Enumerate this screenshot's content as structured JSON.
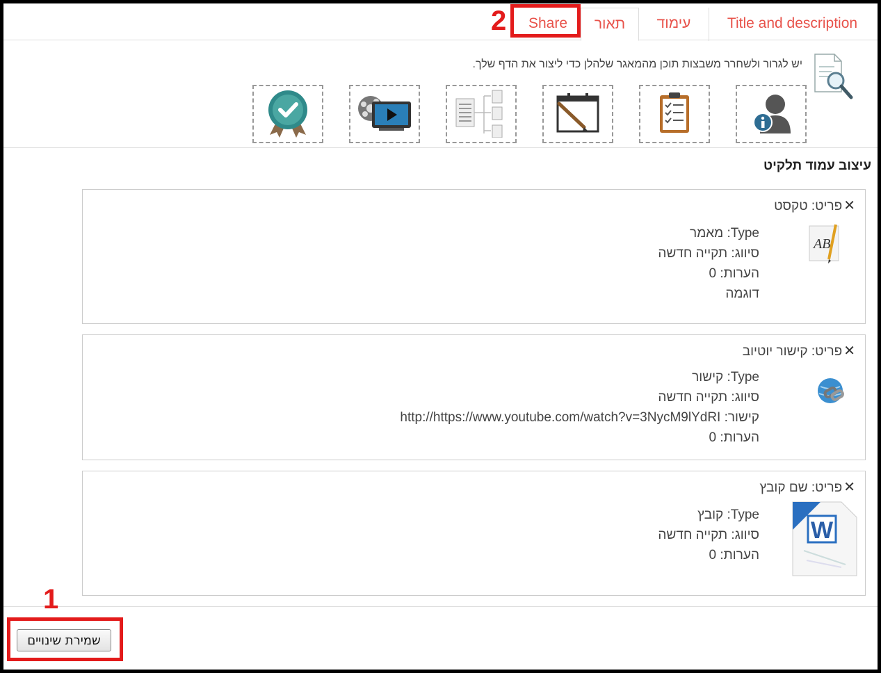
{
  "tabs": {
    "title_description": "Title and description",
    "paging": "עימוד",
    "description": "תאור",
    "share": "Share"
  },
  "annotations": {
    "one": "1",
    "two": "2"
  },
  "toolbar": {
    "hint": "יש לגרור ולשחרר משבצות תוכן מהמאגר שלהלן כדי ליצור את הדף שלך.",
    "tools": [
      "user-info-icon",
      "clipboard-checklist-icon",
      "notepad-pencil-icon",
      "sitemap-icon",
      "video-player-icon",
      "certificate-badge-icon"
    ]
  },
  "section": {
    "title": "עיצוב עמוד תלקיט"
  },
  "items": [
    {
      "close": "✕",
      "header": "פריט: טקסט",
      "icon": "text-document-icon",
      "lines": [
        "Type: מאמר",
        "סיווג: תקייה חדשה",
        "הערות: 0",
        "דוגמה"
      ]
    },
    {
      "close": "✕",
      "header": "פריט: קישור יוטיוב",
      "icon": "globe-link-icon",
      "lines": [
        "Type: קישור",
        "סיווג: תקייה חדשה",
        "קישור: http://https://www.youtube.com/watch?v=3NycM9lYdRI",
        "הערות: 0"
      ]
    },
    {
      "close": "✕",
      "header": "פריט: שם קובץ",
      "icon": "word-file-icon",
      "lines": [
        "Type: קובץ",
        "סיווג: תקייה חדשה",
        "הערות: 0"
      ]
    }
  ],
  "save_button": "שמירת שינויים",
  "colors": {
    "accent": "#e8524a",
    "annotation": "#e31b1b"
  }
}
